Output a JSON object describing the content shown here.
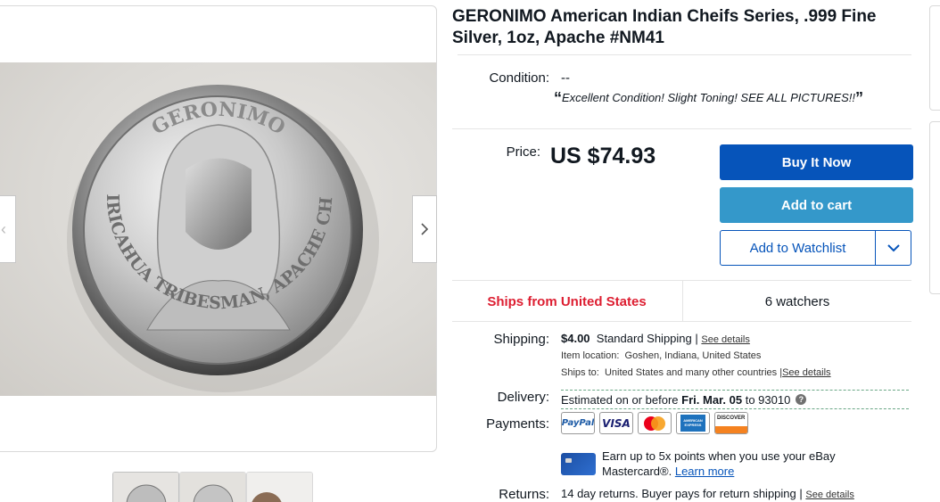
{
  "listing": {
    "title": "GERONIMO American Indian Cheifs Series, .999 Fine Silver, 1oz, Apache #NM41"
  },
  "gallery": {
    "coin_top_text": "GERONIMO",
    "coin_bottom_text": "CHIRICAHUA TRIBESMAN, APACHE CHIEF"
  },
  "condition": {
    "label": "Condition:",
    "value": "--",
    "quote_open": "“",
    "quote": "Excellent Condition! Slight Toning! SEE ALL PICTURES!!",
    "quote_close": "”"
  },
  "price": {
    "label": "Price:",
    "value": "US $74.93"
  },
  "actions": {
    "buy_now": "Buy It Now",
    "add_to_cart": "Add to cart",
    "add_to_watchlist": "Add to Watchlist"
  },
  "signals": {
    "ships_from": "Ships from United States",
    "watchers": "6 watchers"
  },
  "shipping": {
    "label": "Shipping:",
    "cost": "$4.00",
    "method": "Standard Shipping",
    "separator": "|",
    "see_details": "See details",
    "item_location_label": "Item location:",
    "item_location": "Goshen, Indiana, United States",
    "ships_to_label": "Ships to:",
    "ships_to": "United States and many other countries",
    "ships_to_see_details": "See details"
  },
  "delivery": {
    "label": "Delivery:",
    "prefix": "Estimated on or before",
    "date": "Fri. Mar. 05",
    "to": "to 93010",
    "help": "?"
  },
  "payments": {
    "label": "Payments:",
    "paypal": "PayPal",
    "visa": "VISA",
    "discover": "DISCOVER",
    "amex": "AMERICAN EXPRESS"
  },
  "promo": {
    "line1": "Earn up to 5x points when you use your eBay",
    "line2": "Mastercard®.",
    "learn_more": "Learn more"
  },
  "returns": {
    "label": "Returns:",
    "text": "14 day returns. Buyer pays for return shipping",
    "separator": "|",
    "see_details": "See details"
  },
  "colors": {
    "buy_blue": "#0654ba",
    "cart_blue": "#3498ca",
    "ships_red": "#dd1e31",
    "delivery_dash": "#6aa786"
  }
}
